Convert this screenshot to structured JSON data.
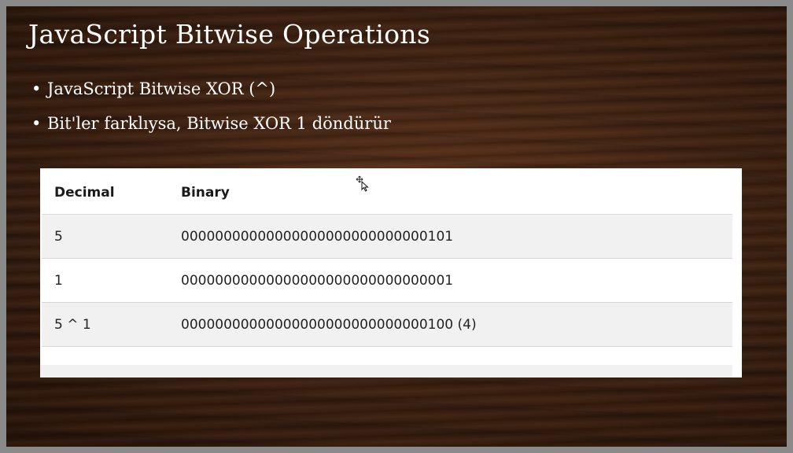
{
  "slide": {
    "title": "JavaScript Bitwise Operations",
    "bullets": [
      "JavaScript Bitwise XOR (^)",
      "Bit'ler farklıysa, Bitwise XOR 1 döndürür"
    ],
    "bullet_symbol": "•"
  },
  "table": {
    "headers": [
      "Decimal",
      "Binary"
    ],
    "rows": [
      [
        "5",
        "00000000000000000000000000000101"
      ],
      [
        "1",
        "00000000000000000000000000000001"
      ],
      [
        "5 ^ 1",
        "00000000000000000000000000000100 (4)"
      ]
    ]
  },
  "colors": {
    "title_text": "#ffffff",
    "table_header_text": "#1a1a1a",
    "row_alt_bg": "#f1f1f1",
    "wood_dark": "#241208",
    "wood_mid": "#5a321c"
  },
  "cursor": {
    "icon": "move-cursor-icon"
  }
}
